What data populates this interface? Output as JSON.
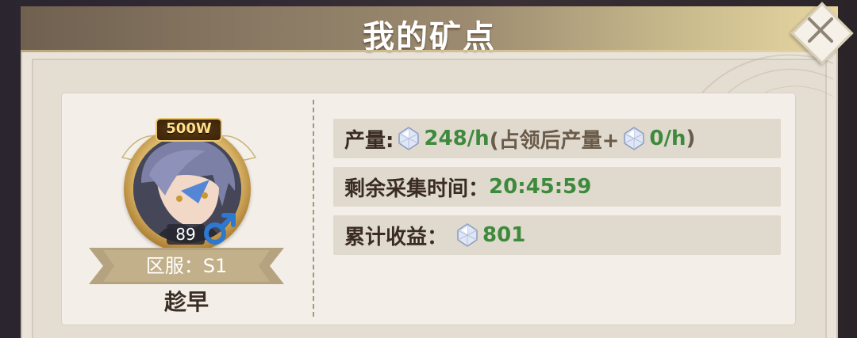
{
  "header": {
    "title": "我的矿点"
  },
  "close": {
    "label": "close"
  },
  "player": {
    "power_badge": "500W",
    "level": "89",
    "server_label": "区服：S1",
    "name": "趁早"
  },
  "info": {
    "production_label": "产量:",
    "production_value": "248/h",
    "occupied_prefix": "(占领后产量+",
    "occupied_value": "0/h",
    "occupied_suffix": ")",
    "remaining_label": "剩余采集时间：",
    "remaining_value": "20:45:59",
    "income_label": "累计收益：",
    "income_value": "801"
  },
  "icons": {
    "gem": "diamond-gem-icon",
    "gender": "male-icon",
    "close": "close-x-icon"
  },
  "colors": {
    "value_green": "#3e8a3c",
    "label_brown": "#3a2c22",
    "header_gold": "#e7d6a2"
  }
}
